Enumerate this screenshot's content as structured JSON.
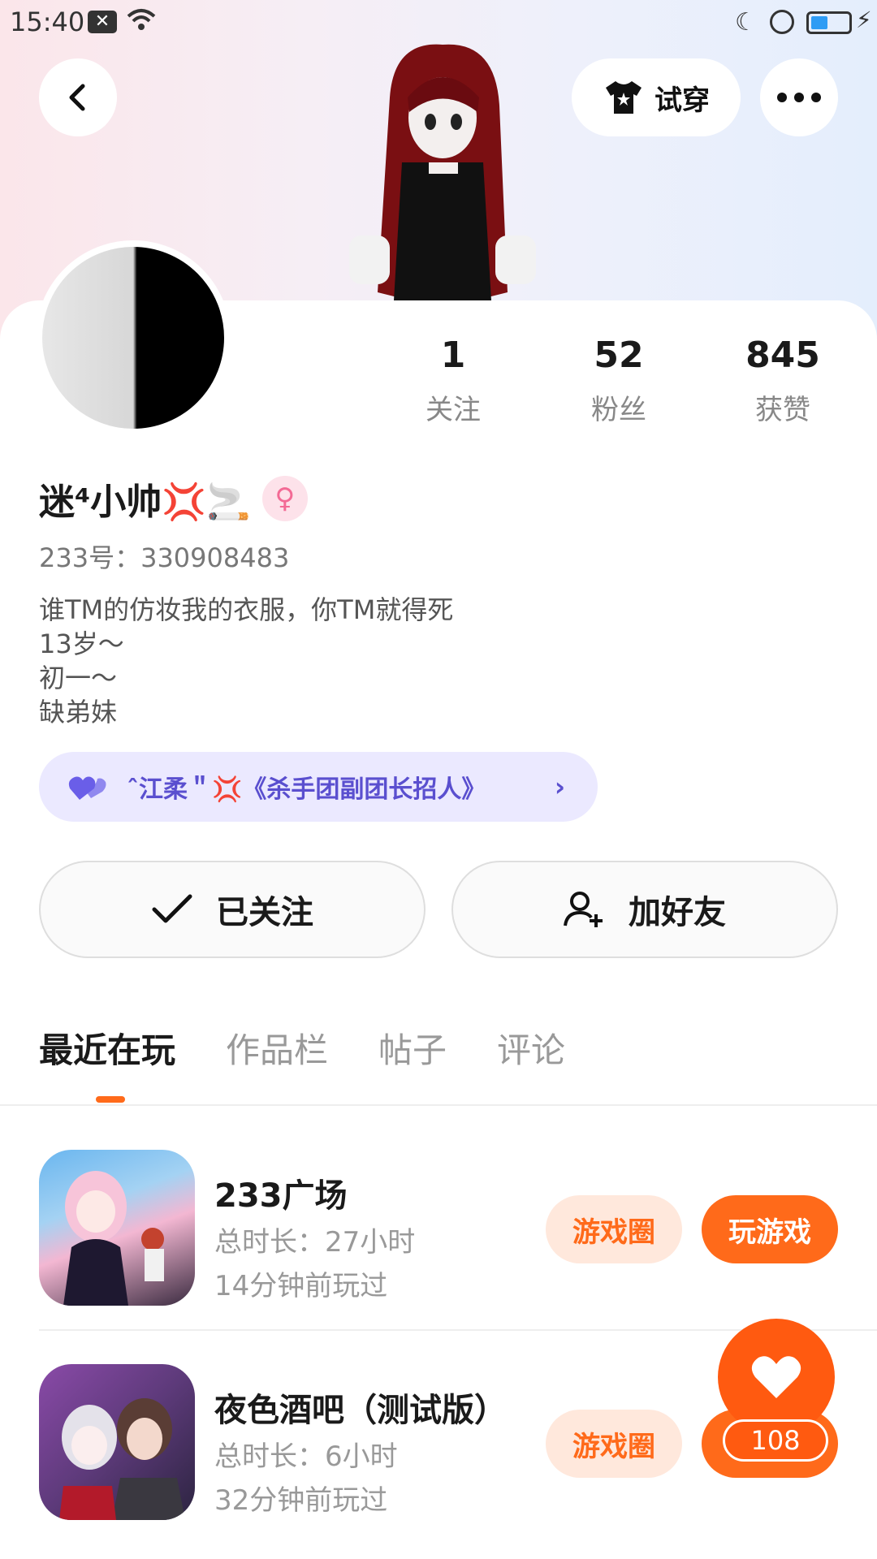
{
  "status_bar": {
    "time": "15:40"
  },
  "header": {
    "try_on_label": "试穿"
  },
  "stats": [
    {
      "value": "1",
      "label": "关注"
    },
    {
      "value": "52",
      "label": "粉丝"
    },
    {
      "value": "845",
      "label": "获赞"
    }
  ],
  "profile": {
    "name": "迷⁴小帅💢🚬",
    "gender_icon": "♀",
    "uid": "233号：330908483",
    "bio": [
      "谁TM的仿妆我的衣服，你TM就得死",
      "13岁～",
      "初一～",
      "缺弟妹"
    ]
  },
  "group": {
    "text": "ˆ江柔＂💢《杀手团副团长招人》"
  },
  "actions": {
    "followed_label": "已关注",
    "add_friend_label": "加好友"
  },
  "tabs": [
    "最近在玩",
    "作品栏",
    "帖子",
    "评论"
  ],
  "games": [
    {
      "title": "233广场",
      "duration": "总时长：27小时",
      "last_played": "14分钟前玩过",
      "circle_label": "游戏圈",
      "play_label": "玩游戏"
    },
    {
      "title": "夜色酒吧（测试版）",
      "duration": "总时长：6小时",
      "last_played": "32分钟前玩过",
      "circle_label": "游戏圈"
    }
  ],
  "like": {
    "count": "108"
  },
  "colors": {
    "accent": "#ff6a1a",
    "pill_bg": "#ebe9ff",
    "pill_text": "#5a4fcf"
  }
}
